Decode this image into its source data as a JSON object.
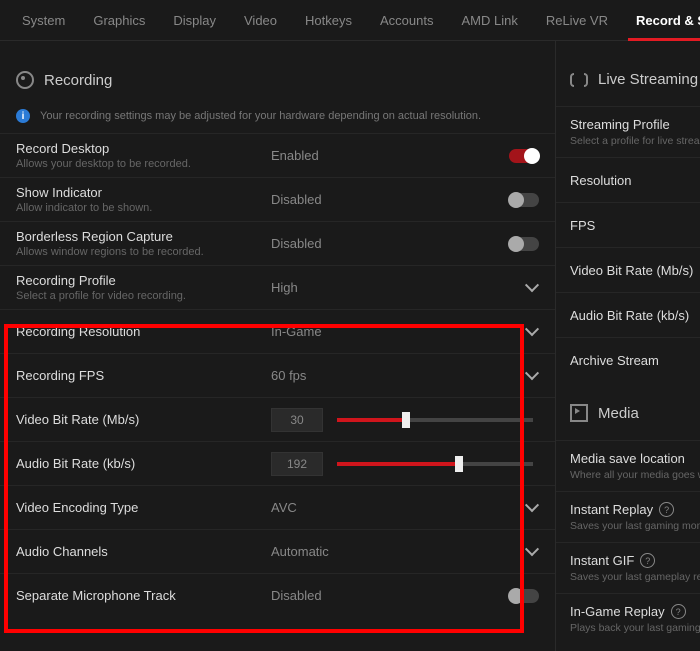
{
  "tabs": {
    "items": [
      "System",
      "Graphics",
      "Display",
      "Video",
      "Hotkeys",
      "Accounts",
      "AMD Link",
      "ReLive VR",
      "Record & Stream"
    ],
    "active": "Record & Stream"
  },
  "recording": {
    "title": "Recording",
    "info": "Your recording settings may be adjusted for your hardware depending on actual resolution.",
    "rows": {
      "record_desktop": {
        "title": "Record Desktop",
        "sub": "Allows your desktop to be recorded.",
        "value": "Enabled",
        "toggle": "on"
      },
      "show_indicator": {
        "title": "Show Indicator",
        "sub": "Allow indicator to be shown.",
        "value": "Disabled",
        "toggle": "off"
      },
      "borderless": {
        "title": "Borderless Region Capture",
        "sub": "Allows window regions to be recorded.",
        "value": "Disabled",
        "toggle": "off"
      },
      "profile": {
        "title": "Recording Profile",
        "sub": "Select a profile for video recording.",
        "value": "High"
      },
      "resolution": {
        "title": "Recording Resolution",
        "value": "In-Game"
      },
      "fps": {
        "title": "Recording FPS",
        "value": "60 fps"
      },
      "vbitrate": {
        "title": "Video Bit Rate (Mb/s)",
        "value": "30",
        "pct": 35
      },
      "abitrate": {
        "title": "Audio Bit Rate (kb/s)",
        "value": "192",
        "pct": 62
      },
      "encoding": {
        "title": "Video Encoding Type",
        "value": "AVC"
      },
      "channels": {
        "title": "Audio Channels",
        "value": "Automatic"
      },
      "mic": {
        "title": "Separate Microphone Track",
        "value": "Disabled",
        "toggle": "off"
      }
    }
  },
  "live": {
    "title": "Live Streaming",
    "items": [
      {
        "t": "Streaming Profile",
        "s": "Select a profile for live streaming."
      },
      {
        "t": "Resolution"
      },
      {
        "t": "FPS"
      },
      {
        "t": "Video Bit Rate (Mb/s)"
      },
      {
        "t": "Audio Bit Rate (kb/s)"
      },
      {
        "t": "Archive Stream"
      }
    ]
  },
  "media": {
    "title": "Media",
    "items": [
      {
        "t": "Media save location",
        "s": "Where all your media goes when saved."
      },
      {
        "t": "Instant Replay",
        "s": "Saves your last gaming moment.",
        "q": true
      },
      {
        "t": "Instant GIF",
        "s": "Saves your last gameplay replay.",
        "q": true
      },
      {
        "t": "In-Game Replay",
        "s": "Plays back your last gaming moment.",
        "q": true
      }
    ]
  }
}
